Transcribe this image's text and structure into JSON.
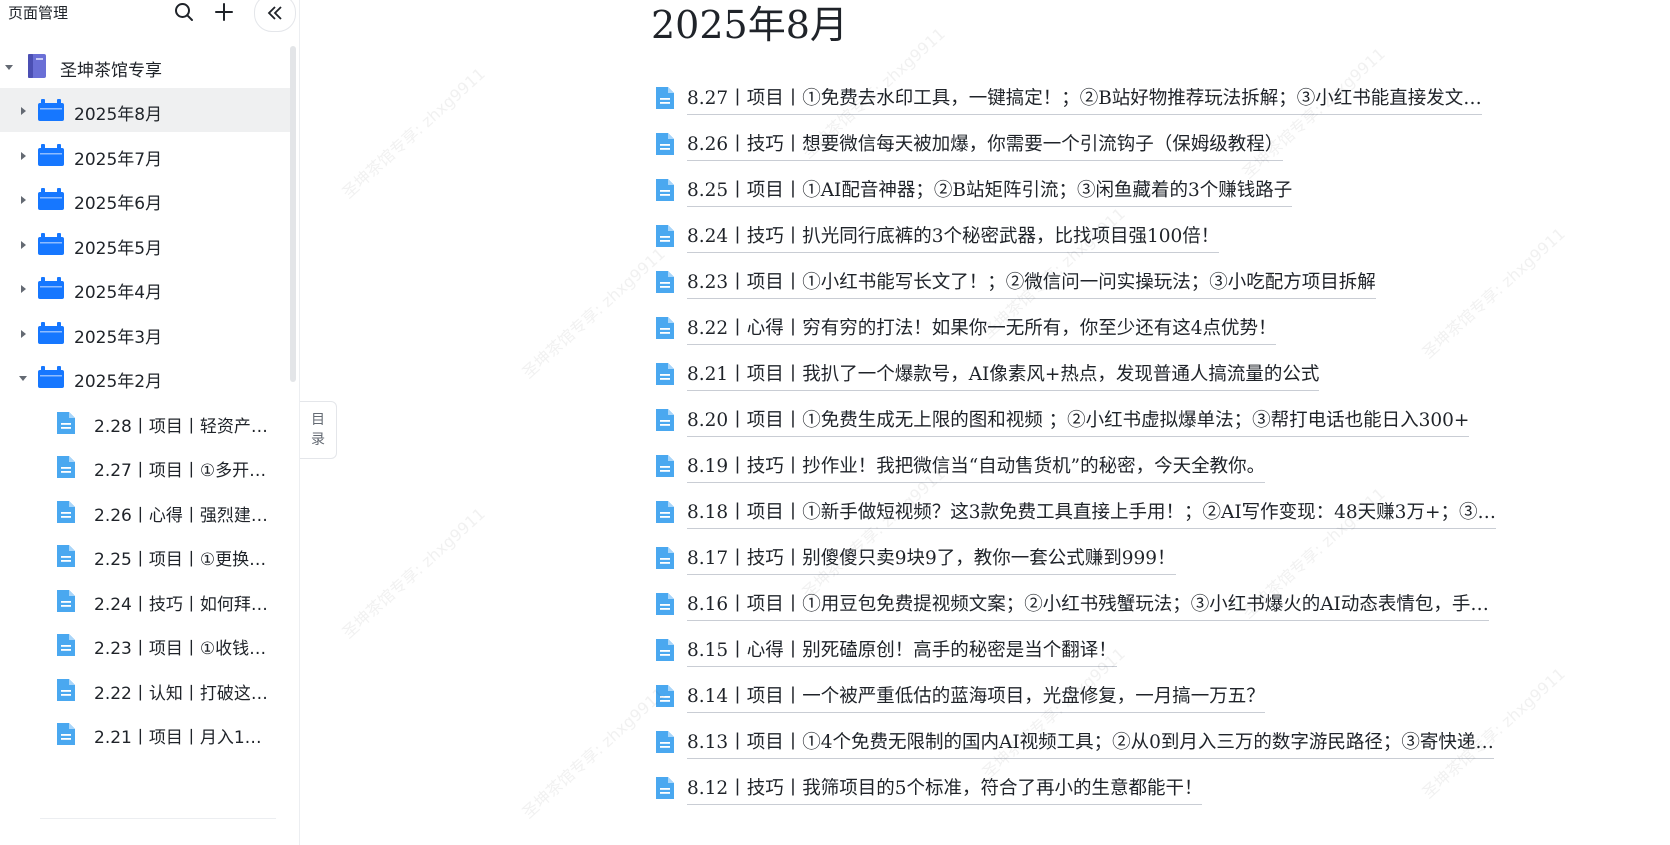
{
  "sidebar": {
    "title": "页面管理",
    "icons": {
      "search": "search-icon",
      "add": "plus-icon",
      "collapse": "double-chevron-left-icon"
    },
    "root": {
      "label": "圣坤茶馆专享",
      "icon": "notebook-icon"
    },
    "folders": [
      {
        "label": "2025年8月",
        "selected": true
      },
      {
        "label": "2025年7月"
      },
      {
        "label": "2025年6月"
      },
      {
        "label": "2025年5月"
      },
      {
        "label": "2025年4月"
      },
      {
        "label": "2025年3月"
      },
      {
        "label": "2025年2月",
        "expanded": true
      }
    ],
    "docs": [
      {
        "label": "2.28丨项目丨轻资产…"
      },
      {
        "label": "2.27丨项目丨①多开…"
      },
      {
        "label": "2.26丨心得丨强烈建…"
      },
      {
        "label": "2.25丨项目丨①更换…"
      },
      {
        "label": "2.24丨技巧丨如何拜…"
      },
      {
        "label": "2.23丨项目丨①收钱…"
      },
      {
        "label": "2.22丨认知丨打破这…"
      },
      {
        "label": "2.21丨项目丨月入1…"
      }
    ]
  },
  "toc": {
    "char1": "目",
    "char2": "录"
  },
  "main": {
    "title": "2025年8月",
    "items": [
      {
        "text": "8.27丨项目丨①免费去水印工具，一键搞定！；②B站好物推荐玩法拆解；③小红书能直接发文…"
      },
      {
        "text": "8.26丨技巧丨想要微信每天被加爆，你需要一个引流钩子（保姆级教程）"
      },
      {
        "text": "8.25丨项目丨①AI配音神器；②B站矩阵引流；③闲鱼藏着的3个赚钱路子"
      },
      {
        "text": "8.24丨技巧丨扒光同行底裤的3个秘密武器，比找项目强100倍！"
      },
      {
        "text": "8.23丨项目丨①小红书能写长文了！；②微信问一问实操玩法；③小吃配方项目拆解"
      },
      {
        "text": "8.22丨心得丨穷有穷的打法！如果你一无所有，你至少还有这4点优势！"
      },
      {
        "text": "8.21丨项目丨我扒了一个爆款号，AI像素风+热点，发现普通人搞流量的公式"
      },
      {
        "text": "8.20丨项目丨①免费生成无上限的图和视频 ；②小红书虚拟爆单法；③帮打电话也能日入300+"
      },
      {
        "text": "8.19丨技巧丨抄作业！我把微信当“自动售货机”的秘密，今天全教你。"
      },
      {
        "text": "8.18丨项目丨①新手做短视频？这3款免费工具直接上手用！；②AI写作变现：48天赚3万+；③…"
      },
      {
        "text": "8.17丨技巧丨别傻傻只卖9块9了，教你一套公式赚到999！"
      },
      {
        "text": "8.16丨项目丨①用豆包免费提视频文案；②小红书残蟹玩法；③小红书爆火的AI动态表情包，手…"
      },
      {
        "text": "8.15丨心得丨别死磕原创！高手的秘密是当个翻译！"
      },
      {
        "text": "8.14丨项目丨一个被严重低估的蓝海项目，光盘修复，一月搞一万五？"
      },
      {
        "text": "8.13丨项目丨①4个免费无限制的国内AI视频工具；②从0到月入三万的数字游民路径；③寄快递…"
      },
      {
        "text": "8.12丨技巧丨我筛项目的5个标准，符合了再小的生意都能干！"
      }
    ]
  },
  "watermark": {
    "text": "圣坤茶馆专享: zhxg9911"
  },
  "colors": {
    "folder_blue": "#1677ff",
    "doc_blue": "#4aa8f0",
    "selected_bg": "#eff0f1",
    "notebook_purple": "#5b5fc7"
  }
}
